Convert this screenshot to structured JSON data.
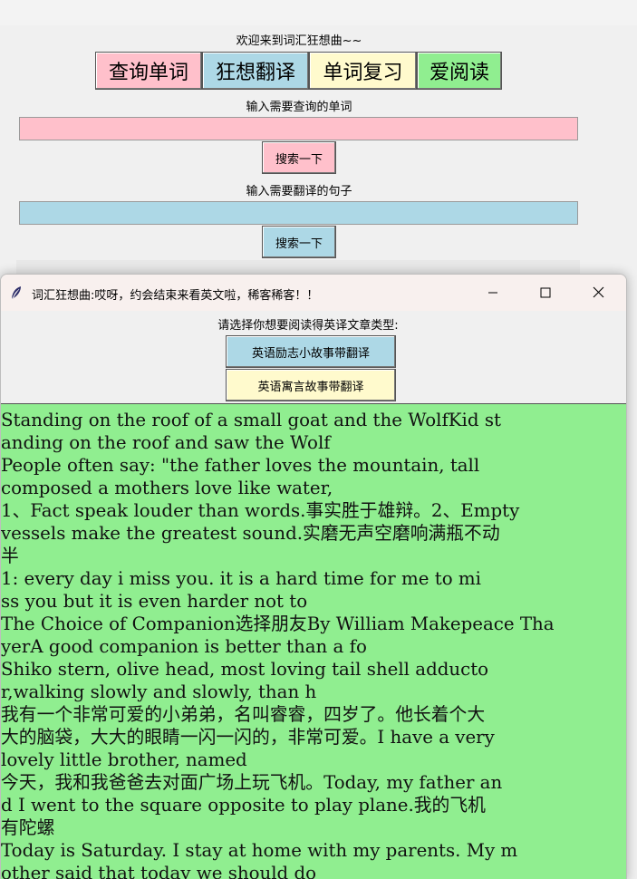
{
  "main": {
    "welcome": "欢迎来到词汇狂想曲~~",
    "tabs": [
      {
        "label": "查询单词",
        "color": "#ffc0cb"
      },
      {
        "label": "狂想翻译",
        "color": "#add8e6"
      },
      {
        "label": "单词复习",
        "color": "#fffacd"
      },
      {
        "label": "爱阅读",
        "color": "#90ee90"
      }
    ],
    "word_prompt": "输入需要查询的单词",
    "word_input_value": "",
    "word_search": "搜索一下",
    "sentence_prompt": "输入需要翻译的句子",
    "sentence_input_value": "",
    "sentence_search": "搜索一下",
    "colors": {
      "pink": "#ffc0cb",
      "blue": "#add8e6",
      "yellow": "#fffacd",
      "green": "#90ee90"
    }
  },
  "popup": {
    "title": "词汇狂想曲:哎呀，约会结束来看英文啦，稀客稀客！！",
    "app_icon": "feather-icon",
    "controls": {
      "minimize": "minimize-icon",
      "maximize": "maximize-icon",
      "close": "close-icon"
    },
    "prompt": "请选择你想要阅读得英译文章类型:",
    "buttons": [
      {
        "label": "英语励志小故事带翻译"
      },
      {
        "label": "英语寓言故事带翻译"
      }
    ],
    "articles": [
      "Standing on the roof of a small goat and the WolfKid st",
      "anding on the roof and saw the Wolf",
      "People often say: \"the father loves the mountain, tall",
      "composed a mothers love like water,",
      "1、Fact speak louder than words.事实胜于雄辩。2、Empty",
      "vessels make the greatest sound.实磨无声空磨响满瓶不动",
      "半",
      "1: every day i miss you. it is a hard time for me to mi",
      "ss you but it is even harder not to",
      "The Choice of Companion选择朋友By William Makepeace Tha",
      "yerA good companion is better than a fo",
      "Shiko stern, olive head, most loving tail shell adducto",
      "r,walking slowly and slowly, than h",
      "我有一个非常可爱的小弟弟，名叫睿睿，四岁了。他长着个大",
      "大的脑袋，大大的眼睛一闪一闪的，非常可爱。I have a very",
      "lovely little brother, named",
      "今天，我和我爸爸去对面广场上玩飞机。Today, my father an",
      "d I went to the square opposite to play plane.我的飞机",
      "有陀螺",
      "Today is Saturday. I stay at home with my parents. My m",
      "other said that today we should do"
    ]
  }
}
